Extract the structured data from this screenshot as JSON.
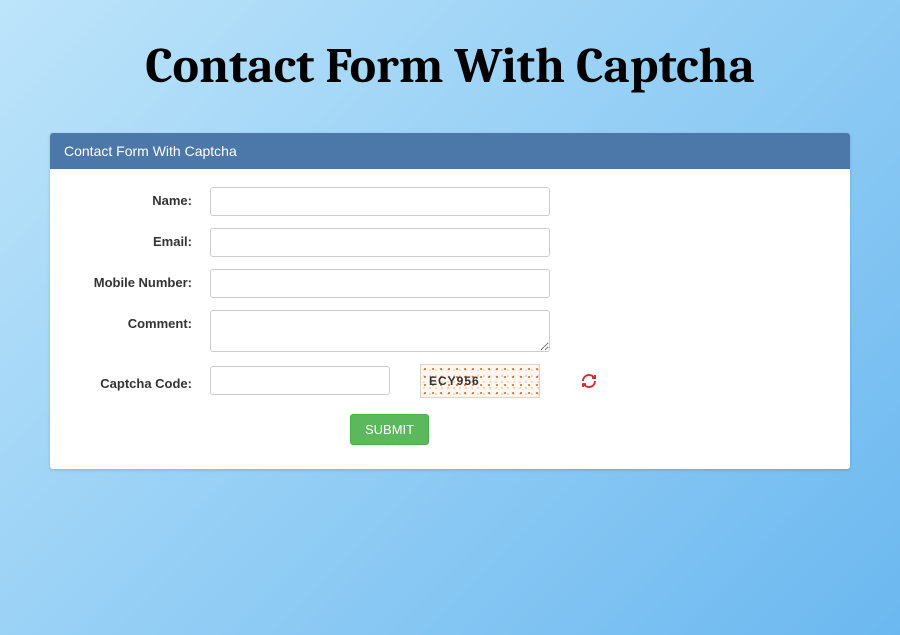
{
  "page_title": "Contact Form With Captcha",
  "panel": {
    "header": "Contact Form With Captcha"
  },
  "form": {
    "name": {
      "label": "Name:",
      "value": ""
    },
    "email": {
      "label": "Email:",
      "value": ""
    },
    "mobile": {
      "label": "Mobile Number:",
      "value": ""
    },
    "comment": {
      "label": "Comment:",
      "value": ""
    },
    "captcha": {
      "label": "Captcha Code:",
      "value": "",
      "code": "ECY956"
    },
    "submit": {
      "label": "SUBMIT"
    }
  }
}
